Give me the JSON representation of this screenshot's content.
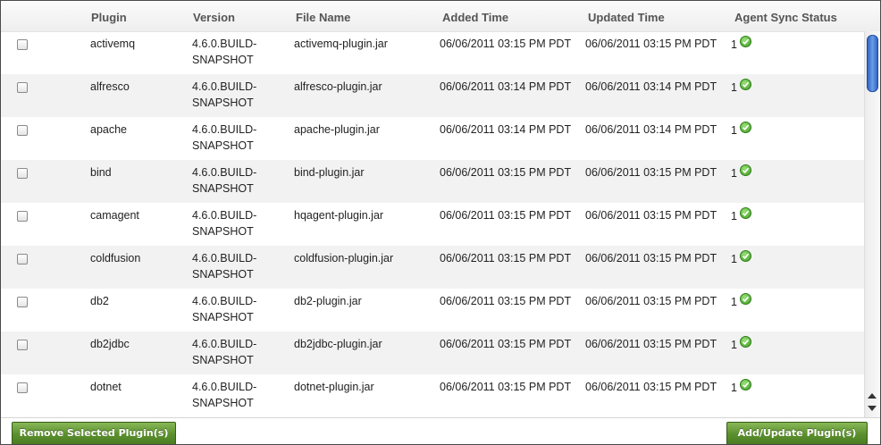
{
  "columns": {
    "plugin": "Plugin",
    "version": "Version",
    "file_name": "File Name",
    "added_time": "Added Time",
    "updated_time": "Updated Time",
    "agent_sync_status": "Agent Sync Status"
  },
  "rows": [
    {
      "plugin": "activemq",
      "version_line1": "4.6.0.BUILD-",
      "version_line2": "SNAPSHOT",
      "file": "activemq-plugin.jar",
      "added": "06/06/2011 03:15 PM PDT",
      "updated": "06/06/2011 03:15 PM PDT",
      "sync_count": "1",
      "sync_icon": "green-check-circle-icon"
    },
    {
      "plugin": "alfresco",
      "version_line1": "4.6.0.BUILD-",
      "version_line2": "SNAPSHOT",
      "file": "alfresco-plugin.jar",
      "added": "06/06/2011 03:14 PM PDT",
      "updated": "06/06/2011 03:14 PM PDT",
      "sync_count": "1",
      "sync_icon": "green-check-circle-icon"
    },
    {
      "plugin": "apache",
      "version_line1": "4.6.0.BUILD-",
      "version_line2": "SNAPSHOT",
      "file": "apache-plugin.jar",
      "added": "06/06/2011 03:14 PM PDT",
      "updated": "06/06/2011 03:14 PM PDT",
      "sync_count": "1",
      "sync_icon": "green-check-circle-icon"
    },
    {
      "plugin": "bind",
      "version_line1": "4.6.0.BUILD-",
      "version_line2": "SNAPSHOT",
      "file": "bind-plugin.jar",
      "added": "06/06/2011 03:15 PM PDT",
      "updated": "06/06/2011 03:15 PM PDT",
      "sync_count": "1",
      "sync_icon": "green-check-circle-icon"
    },
    {
      "plugin": "camagent",
      "version_line1": "4.6.0.BUILD-",
      "version_line2": "SNAPSHOT",
      "file": "hqagent-plugin.jar",
      "added": "06/06/2011 03:15 PM PDT",
      "updated": "06/06/2011 03:15 PM PDT",
      "sync_count": "1",
      "sync_icon": "green-check-circle-icon"
    },
    {
      "plugin": "coldfusion",
      "version_line1": "4.6.0.BUILD-",
      "version_line2": "SNAPSHOT",
      "file": "coldfusion-plugin.jar",
      "added": "06/06/2011 03:15 PM PDT",
      "updated": "06/06/2011 03:15 PM PDT",
      "sync_count": "1",
      "sync_icon": "green-check-circle-icon"
    },
    {
      "plugin": "db2",
      "version_line1": "4.6.0.BUILD-",
      "version_line2": "SNAPSHOT",
      "file": "db2-plugin.jar",
      "added": "06/06/2011 03:15 PM PDT",
      "updated": "06/06/2011 03:15 PM PDT",
      "sync_count": "1",
      "sync_icon": "green-check-circle-icon"
    },
    {
      "plugin": "db2jdbc",
      "version_line1": "4.6.0.BUILD-",
      "version_line2": "SNAPSHOT",
      "file": "db2jdbc-plugin.jar",
      "added": "06/06/2011 03:15 PM PDT",
      "updated": "06/06/2011 03:15 PM PDT",
      "sync_count": "1",
      "sync_icon": "green-check-circle-icon"
    },
    {
      "plugin": "dotnet",
      "version_line1": "4.6.0.BUILD-",
      "version_line2": "SNAPSHOT",
      "file": "dotnet-plugin.jar",
      "added": "06/06/2011 03:15 PM PDT",
      "updated": "06/06/2011 03:15 PM PDT",
      "sync_count": "1",
      "sync_icon": "green-check-circle-icon"
    }
  ],
  "buttons": {
    "remove": "Remove Selected Plugin(s)",
    "add_update": "Add/Update Plugin(s)"
  },
  "colors": {
    "button_green": "#5a8f2d",
    "row_alt": "#f2f2f2",
    "sync_ok": "#3e9c22",
    "scroll_thumb": "#2f66c4"
  }
}
